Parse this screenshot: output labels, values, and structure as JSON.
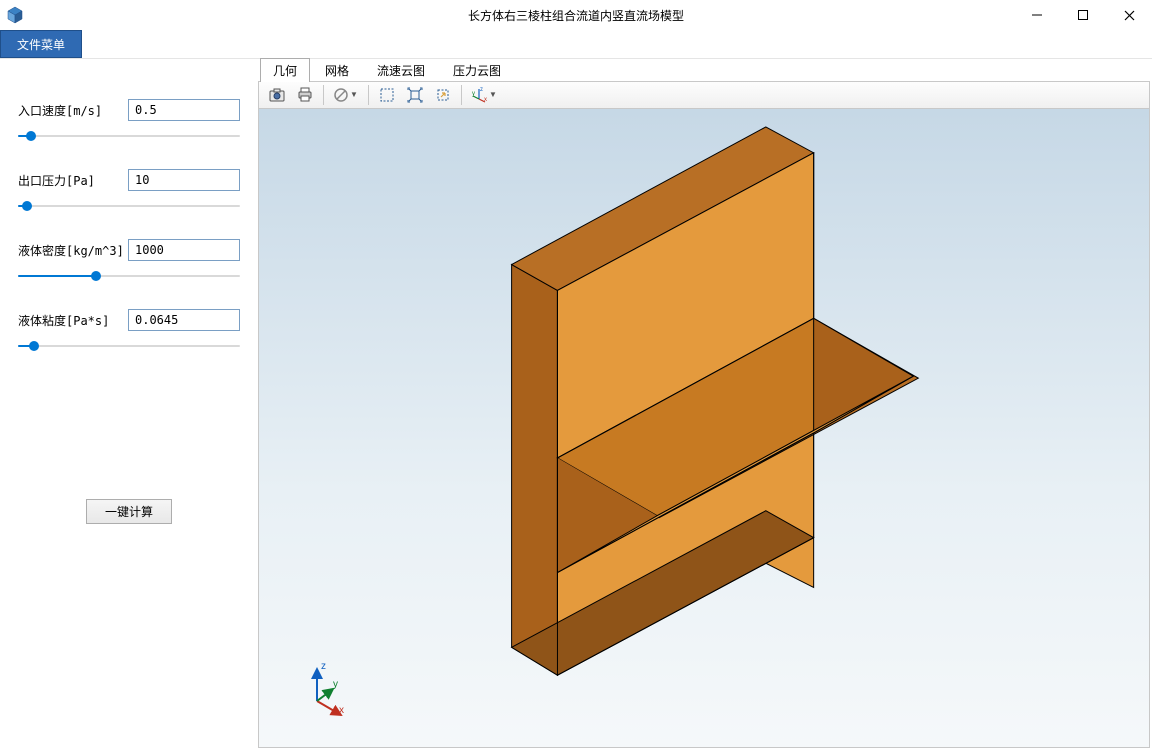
{
  "window": {
    "title": "长方体右三棱柱组合流道内竖直流场模型"
  },
  "menubar": {
    "file": "文件菜单"
  },
  "sidebar": {
    "params": [
      {
        "label": "入口速度[m/s]",
        "value": "0.5",
        "slider_fill_pct": 6,
        "slider_thumb_pct": 6
      },
      {
        "label": "出口压力[Pa]",
        "value": "10",
        "slider_fill_pct": 4,
        "slider_thumb_pct": 4
      },
      {
        "label": "液体密度[kg/m^3]",
        "value": "1000",
        "slider_fill_pct": 35,
        "slider_thumb_pct": 35
      },
      {
        "label": "液体粘度[Pa*s]",
        "value": "0.0645",
        "slider_fill_pct": 7,
        "slider_thumb_pct": 7
      }
    ],
    "compute_label": "一键计算"
  },
  "tabs": {
    "items": [
      {
        "label": "几何",
        "active": true
      },
      {
        "label": "网格",
        "active": false
      },
      {
        "label": "流速云图",
        "active": false
      },
      {
        "label": "压力云图",
        "active": false
      }
    ]
  },
  "toolbar_icons": {
    "camera": "camera-icon",
    "print": "print-icon",
    "nodraw": "no-entry-icon",
    "select_rect": "select-rect-icon",
    "fit": "fit-view-icon",
    "highlight": "highlight-icon",
    "axis": "axis-orient-icon"
  },
  "triad": {
    "x": "x",
    "y": "y",
    "z": "z"
  },
  "colors": {
    "accent": "#2f6ab3",
    "model_face_top": "#b86f25",
    "model_face_front": "#e49a3d",
    "model_face_side": "#a9611b"
  }
}
